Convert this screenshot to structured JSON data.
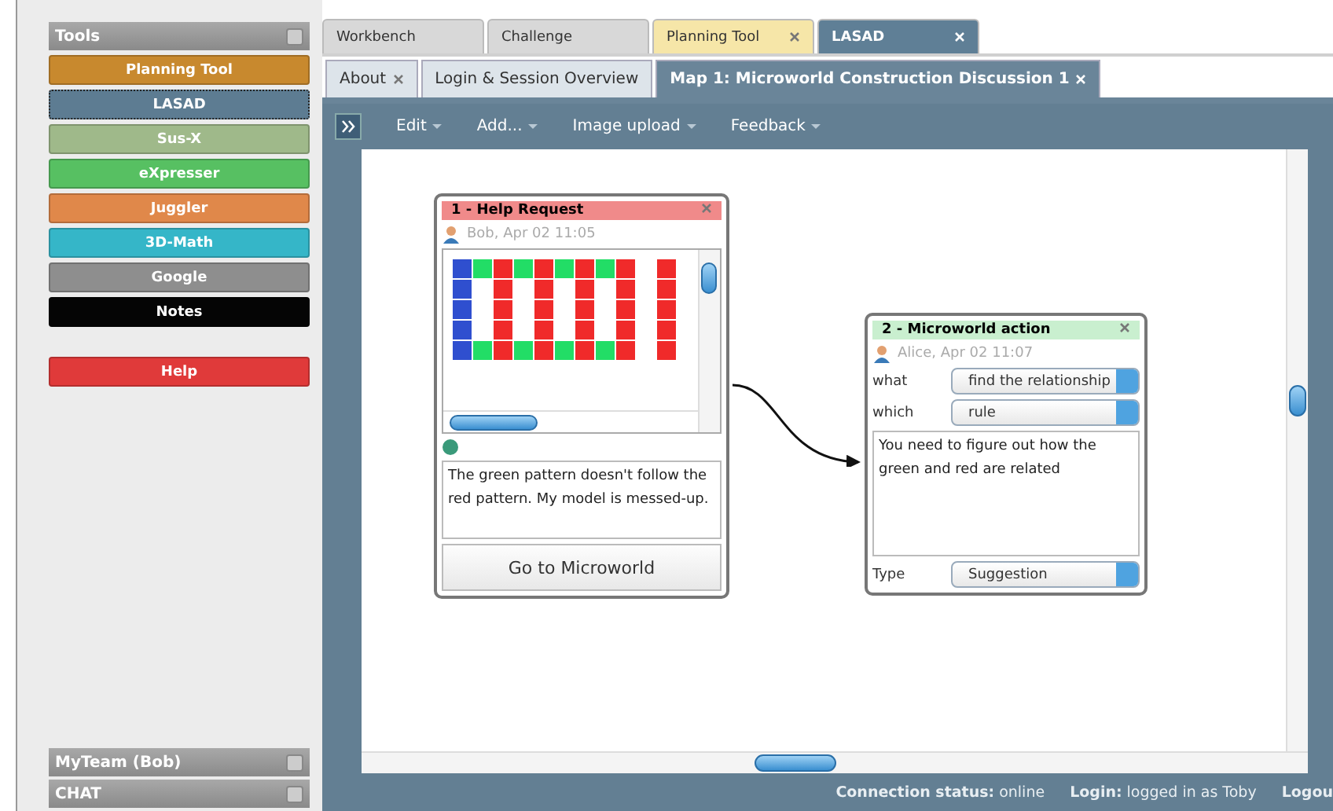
{
  "sidebar": {
    "title": "Tools",
    "tools": [
      {
        "label": "Planning Tool",
        "color": "#c8892e",
        "selected": false
      },
      {
        "label": "LASAD",
        "color": "#5d7c92",
        "selected": true
      },
      {
        "label": "Sus-X",
        "color": "#9fb98a",
        "selected": false
      },
      {
        "label": "eXpresser",
        "color": "#57c062",
        "selected": false
      },
      {
        "label": "Juggler",
        "color": "#e0884a",
        "selected": false
      },
      {
        "label": "3D-Math",
        "color": "#35b6c8",
        "selected": false
      },
      {
        "label": "Google",
        "color": "#8e8e8e",
        "selected": false
      },
      {
        "label": "Notes",
        "color": "#050505",
        "selected": false
      }
    ],
    "help": {
      "label": "Help",
      "color": "#e03a3a"
    },
    "panels": [
      {
        "title": "MyTeam (Bob)"
      },
      {
        "title": "CHAT"
      }
    ]
  },
  "tabs": [
    {
      "label": "Workbench",
      "selected": false,
      "kind": "plain"
    },
    {
      "label": "Challenge",
      "selected": false,
      "kind": "plain"
    },
    {
      "label": "Planning Tool",
      "selected": false,
      "kind": "highlight"
    },
    {
      "label": "LASAD",
      "selected": true,
      "kind": "plain"
    }
  ],
  "subtabs": [
    {
      "label": "About",
      "selected": false,
      "closable": true
    },
    {
      "label": "Login & Session Overview",
      "selected": false,
      "closable": false
    },
    {
      "label": "Map 1: Microworld Construction Discussion 1",
      "selected": true,
      "closable": true
    }
  ],
  "toolbar": [
    "Edit",
    "Add...",
    "Image upload",
    "Feedback"
  ],
  "nodes": [
    {
      "kind": "help",
      "title": "1 - Help Request",
      "color": "#f08a8a",
      "author": "Bob, Apr 02 11:05",
      "text": "The green pattern doesn't follow the red pattern.  My model is messed-up.",
      "button": "Go to Microworld"
    },
    {
      "kind": "action",
      "title": "2 - Microworld action",
      "color": "#c9efcf",
      "author": "Alice, Apr 02 11:07",
      "fields": [
        {
          "label": "what",
          "value": "find the relationship"
        },
        {
          "label": "which",
          "value": "rule"
        }
      ],
      "text": "You need to figure out how the green and red are related",
      "type_label": "Type",
      "type_value": "Suggestion"
    }
  ],
  "status": {
    "connection_label": "Connection status:",
    "connection": "online",
    "login_label": "Login:",
    "login": "logged in as Toby",
    "logout": "Logou"
  }
}
